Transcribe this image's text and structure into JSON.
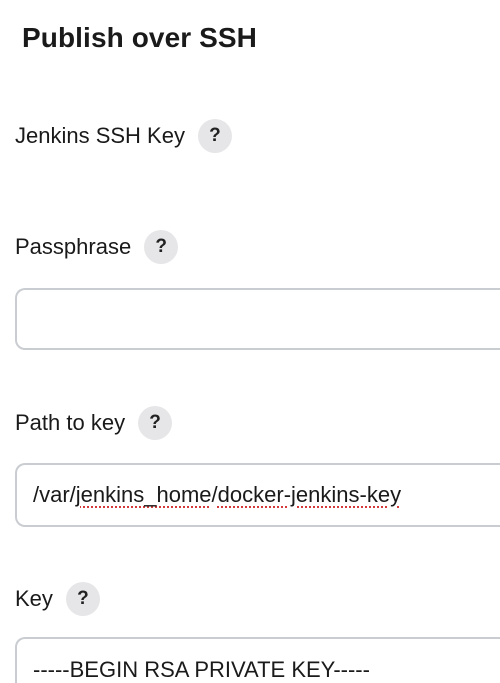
{
  "section": {
    "title": "Publish over SSH"
  },
  "fields": {
    "jenkins_ssh_key": {
      "label": "Jenkins SSH Key",
      "help": "?"
    },
    "passphrase": {
      "label": "Passphrase",
      "help": "?",
      "value": ""
    },
    "path_to_key": {
      "label": "Path to key",
      "help": "?",
      "value_parts": [
        "/var/",
        "jenkins_home",
        "/",
        "docker-jenkins-key"
      ]
    },
    "key": {
      "label": "Key",
      "help": "?",
      "value": "-----BEGIN RSA PRIVATE KEY-----"
    }
  }
}
